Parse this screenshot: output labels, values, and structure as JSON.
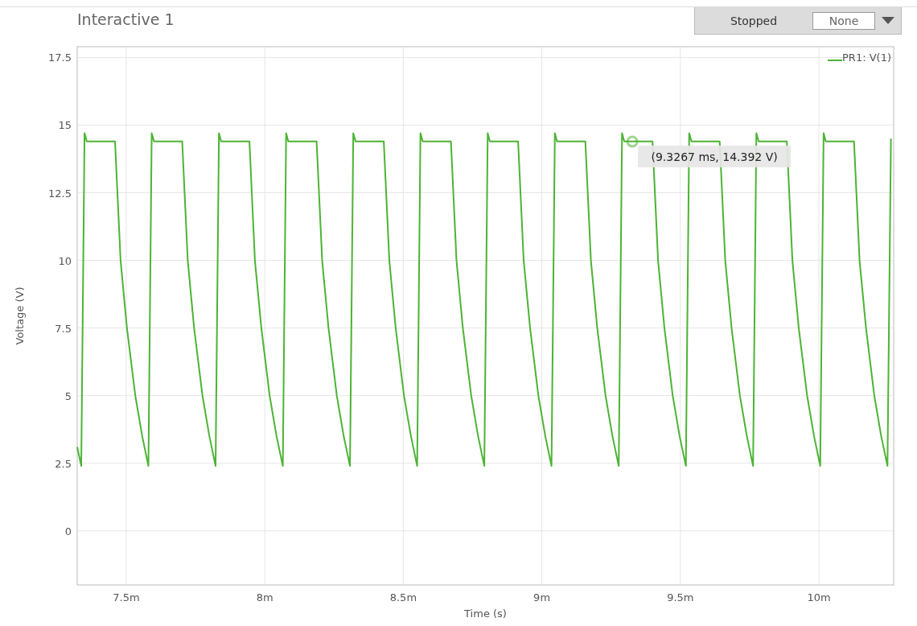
{
  "header": {
    "title": "Interactive 1",
    "status": "Stopped",
    "dropdown": {
      "value": "None"
    }
  },
  "plot": {
    "chart_data": {
      "type": "line",
      "grid": true,
      "xlabel": "Time (s)",
      "ylabel": "Voltage (V)",
      "xlim": [
        7.323,
        10.27
      ],
      "ylim": [
        -2,
        17.9
      ],
      "xticks": [
        {
          "value": 7.5,
          "label": "7.5m"
        },
        {
          "value": 8,
          "label": "8m"
        },
        {
          "value": 8.5,
          "label": "8.5m"
        },
        {
          "value": 9,
          "label": "9m"
        },
        {
          "value": 9.5,
          "label": "9.5m"
        },
        {
          "value": 10,
          "label": "10m"
        }
      ],
      "yticks": [
        0,
        2.5,
        5,
        7.5,
        10,
        12.5,
        15,
        17.5
      ],
      "x": [
        7.323,
        7.3375,
        7.3495,
        7.3575,
        7.4595,
        7.4795,
        7.5025,
        7.5325,
        7.5575,
        7.58,
        7.592,
        7.6,
        7.702,
        7.722,
        7.745,
        7.775,
        7.8,
        7.8225,
        7.8345,
        7.8425,
        7.9445,
        7.9645,
        7.9875,
        8.0175,
        8.0425,
        8.065,
        8.077,
        8.085,
        8.187,
        8.207,
        8.23,
        8.26,
        8.285,
        8.3075,
        8.3195,
        8.3275,
        8.4295,
        8.4495,
        8.4725,
        8.5025,
        8.5275,
        8.55,
        8.562,
        8.57,
        8.672,
        8.692,
        8.715,
        8.745,
        8.77,
        8.7925,
        8.8045,
        8.8125,
        8.9145,
        8.9345,
        8.9575,
        8.9875,
        9.0125,
        9.035,
        9.047,
        9.055,
        9.157,
        9.177,
        9.2,
        9.23,
        9.255,
        9.2775,
        9.2895,
        9.2975,
        9.3995,
        9.4195,
        9.4425,
        9.4725,
        9.4975,
        9.52,
        9.532,
        9.54,
        9.642,
        9.662,
        9.685,
        9.715,
        9.74,
        9.7625,
        9.7745,
        9.7825,
        9.8845,
        9.9045,
        9.9275,
        9.9575,
        9.9825,
        10.005,
        10.017,
        10.025,
        10.127,
        10.147,
        10.17,
        10.2,
        10.225,
        10.2475,
        10.26
      ],
      "series": [
        {
          "name": "PR1: V(1)",
          "color": "#4db335",
          "values": [
            3.1,
            2.4,
            14.7,
            14.4,
            14.4,
            10,
            7.5,
            5,
            3.5,
            2.4,
            14.7,
            14.4,
            14.4,
            10,
            7.5,
            5,
            3.5,
            2.4,
            14.7,
            14.4,
            14.4,
            10,
            7.5,
            5,
            3.5,
            2.4,
            14.7,
            14.4,
            14.4,
            10,
            7.5,
            5,
            3.5,
            2.4,
            14.7,
            14.4,
            14.4,
            10,
            7.5,
            5,
            3.5,
            2.4,
            14.7,
            14.4,
            14.4,
            10,
            7.5,
            5,
            3.5,
            2.4,
            14.7,
            14.4,
            14.4,
            10,
            7.5,
            5,
            3.5,
            2.4,
            14.7,
            14.4,
            14.4,
            10,
            7.5,
            5,
            3.5,
            2.4,
            14.7,
            14.4,
            14.4,
            10,
            7.5,
            5,
            3.5,
            2.4,
            14.7,
            14.4,
            14.4,
            10,
            7.5,
            5,
            3.5,
            2.4,
            14.7,
            14.4,
            14.4,
            10,
            7.5,
            5,
            3.5,
            2.4,
            14.7,
            14.4,
            14.4,
            10,
            7.5,
            5,
            3.5,
            2.4,
            14.5
          ]
        }
      ],
      "annotations": [
        {
          "x": 9.3267,
          "y": 14.392,
          "text": "(9.3267 ms, 14.392 V)"
        }
      ]
    }
  }
}
